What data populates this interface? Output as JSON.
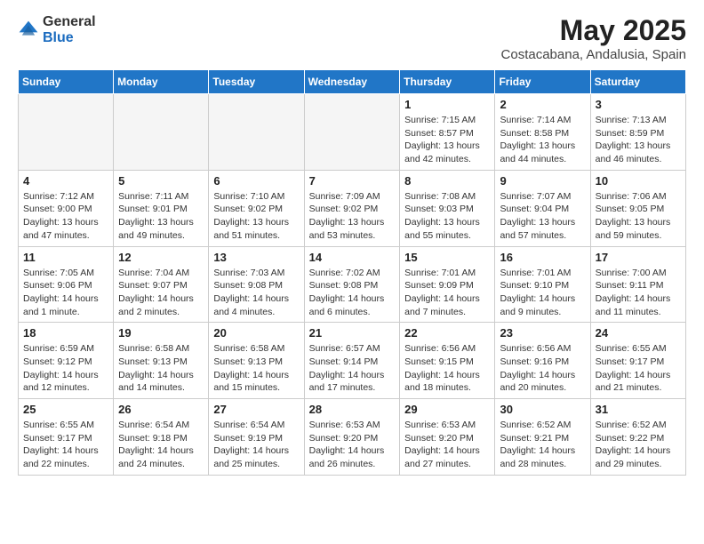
{
  "logo": {
    "general": "General",
    "blue": "Blue"
  },
  "title": "May 2025",
  "location": "Costacabana, Andalusia, Spain",
  "weekdays": [
    "Sunday",
    "Monday",
    "Tuesday",
    "Wednesday",
    "Thursday",
    "Friday",
    "Saturday"
  ],
  "weeks": [
    [
      {
        "day": "",
        "info": ""
      },
      {
        "day": "",
        "info": ""
      },
      {
        "day": "",
        "info": ""
      },
      {
        "day": "",
        "info": ""
      },
      {
        "day": "1",
        "info": "Sunrise: 7:15 AM\nSunset: 8:57 PM\nDaylight: 13 hours\nand 42 minutes."
      },
      {
        "day": "2",
        "info": "Sunrise: 7:14 AM\nSunset: 8:58 PM\nDaylight: 13 hours\nand 44 minutes."
      },
      {
        "day": "3",
        "info": "Sunrise: 7:13 AM\nSunset: 8:59 PM\nDaylight: 13 hours\nand 46 minutes."
      }
    ],
    [
      {
        "day": "4",
        "info": "Sunrise: 7:12 AM\nSunset: 9:00 PM\nDaylight: 13 hours\nand 47 minutes."
      },
      {
        "day": "5",
        "info": "Sunrise: 7:11 AM\nSunset: 9:01 PM\nDaylight: 13 hours\nand 49 minutes."
      },
      {
        "day": "6",
        "info": "Sunrise: 7:10 AM\nSunset: 9:02 PM\nDaylight: 13 hours\nand 51 minutes."
      },
      {
        "day": "7",
        "info": "Sunrise: 7:09 AM\nSunset: 9:02 PM\nDaylight: 13 hours\nand 53 minutes."
      },
      {
        "day": "8",
        "info": "Sunrise: 7:08 AM\nSunset: 9:03 PM\nDaylight: 13 hours\nand 55 minutes."
      },
      {
        "day": "9",
        "info": "Sunrise: 7:07 AM\nSunset: 9:04 PM\nDaylight: 13 hours\nand 57 minutes."
      },
      {
        "day": "10",
        "info": "Sunrise: 7:06 AM\nSunset: 9:05 PM\nDaylight: 13 hours\nand 59 minutes."
      }
    ],
    [
      {
        "day": "11",
        "info": "Sunrise: 7:05 AM\nSunset: 9:06 PM\nDaylight: 14 hours\nand 1 minute."
      },
      {
        "day": "12",
        "info": "Sunrise: 7:04 AM\nSunset: 9:07 PM\nDaylight: 14 hours\nand 2 minutes."
      },
      {
        "day": "13",
        "info": "Sunrise: 7:03 AM\nSunset: 9:08 PM\nDaylight: 14 hours\nand 4 minutes."
      },
      {
        "day": "14",
        "info": "Sunrise: 7:02 AM\nSunset: 9:08 PM\nDaylight: 14 hours\nand 6 minutes."
      },
      {
        "day": "15",
        "info": "Sunrise: 7:01 AM\nSunset: 9:09 PM\nDaylight: 14 hours\nand 7 minutes."
      },
      {
        "day": "16",
        "info": "Sunrise: 7:01 AM\nSunset: 9:10 PM\nDaylight: 14 hours\nand 9 minutes."
      },
      {
        "day": "17",
        "info": "Sunrise: 7:00 AM\nSunset: 9:11 PM\nDaylight: 14 hours\nand 11 minutes."
      }
    ],
    [
      {
        "day": "18",
        "info": "Sunrise: 6:59 AM\nSunset: 9:12 PM\nDaylight: 14 hours\nand 12 minutes."
      },
      {
        "day": "19",
        "info": "Sunrise: 6:58 AM\nSunset: 9:13 PM\nDaylight: 14 hours\nand 14 minutes."
      },
      {
        "day": "20",
        "info": "Sunrise: 6:58 AM\nSunset: 9:13 PM\nDaylight: 14 hours\nand 15 minutes."
      },
      {
        "day": "21",
        "info": "Sunrise: 6:57 AM\nSunset: 9:14 PM\nDaylight: 14 hours\nand 17 minutes."
      },
      {
        "day": "22",
        "info": "Sunrise: 6:56 AM\nSunset: 9:15 PM\nDaylight: 14 hours\nand 18 minutes."
      },
      {
        "day": "23",
        "info": "Sunrise: 6:56 AM\nSunset: 9:16 PM\nDaylight: 14 hours\nand 20 minutes."
      },
      {
        "day": "24",
        "info": "Sunrise: 6:55 AM\nSunset: 9:17 PM\nDaylight: 14 hours\nand 21 minutes."
      }
    ],
    [
      {
        "day": "25",
        "info": "Sunrise: 6:55 AM\nSunset: 9:17 PM\nDaylight: 14 hours\nand 22 minutes."
      },
      {
        "day": "26",
        "info": "Sunrise: 6:54 AM\nSunset: 9:18 PM\nDaylight: 14 hours\nand 24 minutes."
      },
      {
        "day": "27",
        "info": "Sunrise: 6:54 AM\nSunset: 9:19 PM\nDaylight: 14 hours\nand 25 minutes."
      },
      {
        "day": "28",
        "info": "Sunrise: 6:53 AM\nSunset: 9:20 PM\nDaylight: 14 hours\nand 26 minutes."
      },
      {
        "day": "29",
        "info": "Sunrise: 6:53 AM\nSunset: 9:20 PM\nDaylight: 14 hours\nand 27 minutes."
      },
      {
        "day": "30",
        "info": "Sunrise: 6:52 AM\nSunset: 9:21 PM\nDaylight: 14 hours\nand 28 minutes."
      },
      {
        "day": "31",
        "info": "Sunrise: 6:52 AM\nSunset: 9:22 PM\nDaylight: 14 hours\nand 29 minutes."
      }
    ]
  ]
}
